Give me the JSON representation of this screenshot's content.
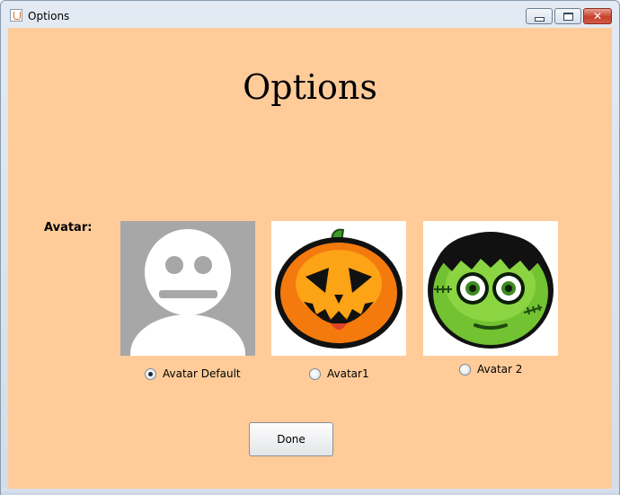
{
  "window": {
    "title": "Options",
    "controls": {
      "minimize_icon": "minimize-icon",
      "maximize_icon": "maximize-icon",
      "close_icon": "close-icon"
    }
  },
  "page": {
    "heading": "Options",
    "avatar_label": "Avatar:",
    "background_color": "#ffcc99"
  },
  "avatars": [
    {
      "icon": "default-avatar-silhouette-icon",
      "label": "Avatar Default",
      "selected": true
    },
    {
      "icon": "jack-o-lantern-avatar-icon",
      "label": "Avatar1",
      "selected": false
    },
    {
      "icon": "frankenstein-avatar-icon",
      "label": "Avatar 2",
      "selected": false
    }
  ],
  "actions": {
    "done_label": "Done"
  }
}
